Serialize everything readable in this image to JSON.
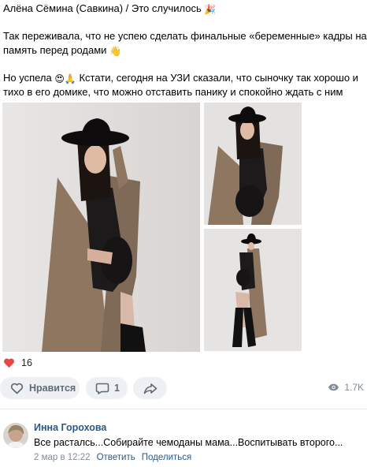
{
  "post": {
    "header_line": "Алёна Сёмина (Савкина) / Это случилось",
    "paragraph_1": "Так переживала, что не успею сделать финальные «беременные» кадры на память перед родами",
    "paragraph_2": "Но успела",
    "paragraph_2_rest": "Кстати, сегодня на УЗИ сказали, что сыночку так хорошо и тихо в его домике, что можно отставить панику и спокойно ждать с ним встречи",
    "emoji_party": "🎉",
    "emoji_hand": "👋",
    "emoji_heart_eyes": "😍",
    "emoji_pray": "🙏",
    "emoji_relieved": "😌"
  },
  "photos": {
    "main_alt": "photo-1",
    "top_alt": "photo-2",
    "bottom_alt": "photo-3"
  },
  "reactions": {
    "likes_count": "16"
  },
  "actions": {
    "like_label": "Нравится",
    "comment_count": "1",
    "views_count": "1.7K"
  },
  "comment": {
    "author": "Инна Горохова",
    "text": "Все расталсь...Собирайте чемоданы мама...Воспитывать второго...",
    "date": "2 мар в 12:22",
    "reply_label": "Ответить",
    "share_label": "Поделиться"
  },
  "colors": {
    "link": "#2a5885",
    "like_red": "#e64646",
    "muted": "#818c99",
    "pill_bg": "#eef0f3",
    "coat": "#8e7661"
  }
}
